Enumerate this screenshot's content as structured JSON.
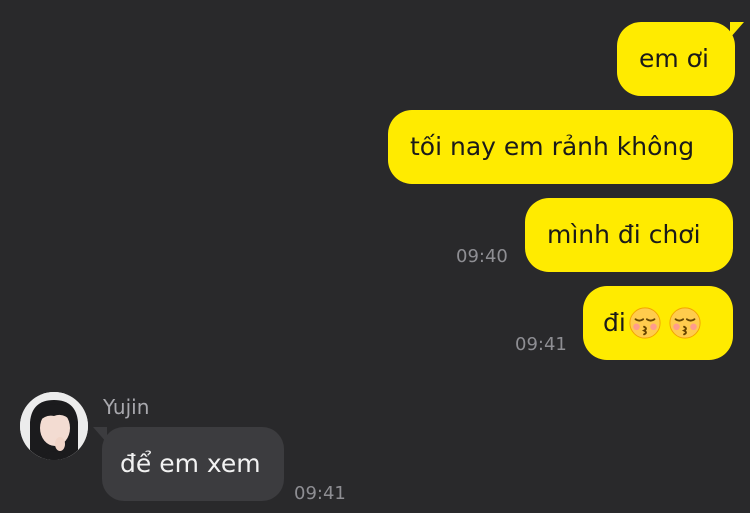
{
  "messages": {
    "m1": {
      "text": "em ơi"
    },
    "m2": {
      "text": "tối nay em rảnh không"
    },
    "m3": {
      "text": "mình đi chơi",
      "time": "09:40"
    },
    "m4": {
      "text": "đi",
      "emojis": [
        "kissing-face-with-closed-eyes",
        "kissing-face-with-closed-eyes"
      ],
      "time": "09:41"
    },
    "m5": {
      "sender": "Yujin",
      "text": "để em xem",
      "time": "09:41"
    }
  },
  "colors": {
    "background": "#29292b",
    "outgoing_bubble": "#ffeb00",
    "incoming_bubble": "#3c3c3f",
    "timestamp": "#8e8e93"
  }
}
